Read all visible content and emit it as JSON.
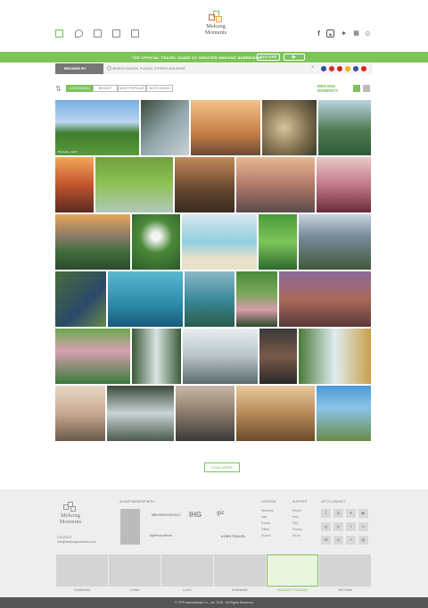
{
  "brand": {
    "line1": "Mekong",
    "line2": "Moments"
  },
  "green_bar": {
    "tagline": "THE OFFICIAL TRAVEL GUIDE OF GREATER MEKONG SUBREGION",
    "explore_label": "EXPLORE",
    "play_label": "▶"
  },
  "browse": {
    "label": "BROWSE BY",
    "search_placeholder": "SEARCH IMAGES, PLACES, STORIES AND MORE"
  },
  "tabs": [
    "CATEGORIES",
    "RECENT",
    "MOST POPULAR",
    "MOST ADDED"
  ],
  "mm_badge": {
    "line1": "MEKONG",
    "line2": "MOMENTS"
  },
  "gallery": {
    "first_caption": "Bromelia_mekfn",
    "load_more": "LOAD MORE"
  },
  "footer": {
    "partnership_title": "IN PARTNERSHIP WITH",
    "partners": [
      "MEKONGCONTACT",
      "IHG",
      "giz",
      "MyPhnomPenh",
      "KHIRI TRAVEL",
      "Mekong Tourism"
    ],
    "contact_title": "CONTACT",
    "contact_email": "info@mekongmoments.com",
    "col1_title": "CONTENT",
    "col1": [
      "Welcome",
      "Map",
      "Events",
      "Offers",
      "Stories"
    ],
    "col2_title": "SUPPORT",
    "col2": [
      "Report",
      "Help",
      "FAQ",
      "Privacy",
      "Terms"
    ],
    "connect_title": "LET'S CONNECT",
    "countries": [
      "CAMBODIA",
      "CHINA",
      "LAOS",
      "MYANMAR",
      "AMAZING THAILAND",
      "VIETNAM"
    ],
    "copyright": "© CPR International Co., Ltd. 2015 · All Rights Reserved"
  }
}
